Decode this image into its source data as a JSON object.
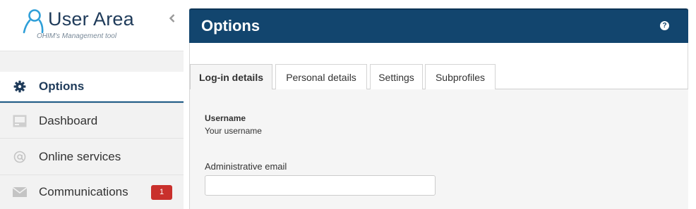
{
  "app": {
    "title": "User Area",
    "subtitle": "OHIM's Management tool"
  },
  "sidebar": {
    "items": [
      {
        "label": "Options",
        "icon": "gear-icon",
        "active": true
      },
      {
        "label": "Dashboard",
        "icon": "dashboard-icon",
        "active": false
      },
      {
        "label": "Online services",
        "icon": "at-icon",
        "active": false
      },
      {
        "label": "Communications",
        "icon": "envelope-icon",
        "active": false,
        "badge": "1"
      }
    ]
  },
  "panel": {
    "title": "Options",
    "help_symbol": "?"
  },
  "tabs": [
    {
      "label": "Log-in details",
      "active": true
    },
    {
      "label": "Personal details",
      "active": false
    },
    {
      "label": "Settings",
      "active": false
    },
    {
      "label": "Subprofiles",
      "active": false
    }
  ],
  "form": {
    "username_label": "Username",
    "username_value": "Your username",
    "email_label": "Administrative email",
    "email_value": ""
  },
  "colors": {
    "brand_dark": "#12456e",
    "logo_text": "#1f3b5a",
    "badge": "#c9302c",
    "active_underline": "#1e5a86"
  }
}
